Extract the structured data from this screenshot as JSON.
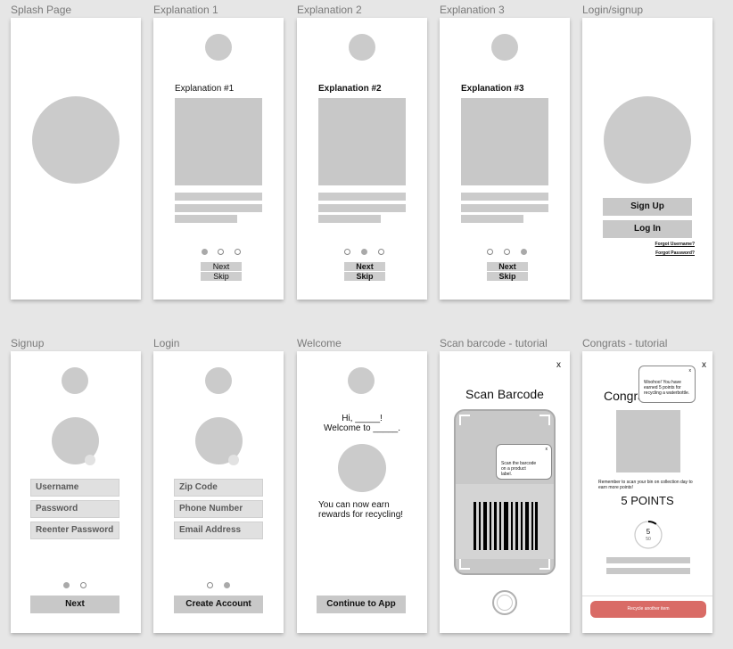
{
  "frames": {
    "splash": {
      "label": "Splash Page"
    },
    "exp1": {
      "label": "Explanation 1",
      "heading": "Explanation #1",
      "next": "Next",
      "skip": "Skip"
    },
    "exp2": {
      "label": "Explanation 2",
      "heading": "Explanation #2",
      "next": "Next",
      "skip": "Skip"
    },
    "exp3": {
      "label": "Explanation 3",
      "heading": "Explanation #3",
      "next": "Next",
      "skip": "Skip"
    },
    "loginsignup": {
      "label": "Login/signup",
      "signup": "Sign Up",
      "login": "Log In",
      "forgot_username": "Forgot Username?",
      "forgot_password": "Forgot Password?"
    },
    "signup": {
      "label": "Signup",
      "fields": [
        "Username",
        "Password",
        "Reenter Password"
      ],
      "next": "Next"
    },
    "login": {
      "label": "Login",
      "fields": [
        "Zip Code",
        "Phone Number",
        "Email Address"
      ],
      "create": "Create Account"
    },
    "welcome": {
      "label": "Welcome",
      "greeting_line1": "Hi, _____!",
      "greeting_line2": "Welcome to _____.",
      "message": "You can now earn rewards for recycling!",
      "continue": "Continue to App"
    },
    "scan": {
      "label": "Scan barcode - tutorial",
      "close": "x",
      "title": "Scan Barcode",
      "tooltip_close": "x",
      "tooltip": "Scan the barcode on a product label."
    },
    "congrats": {
      "label": "Congrats - tutorial",
      "close": "x",
      "title_partial": "Congra",
      "tooltip_close": "x",
      "tooltip": "Woohoo! You have earned 5 points for recycling a waterbottle.",
      "reminder": "Remember to scan your bin on collection day to earn more points!",
      "points": "5 POINTS",
      "progress_value": "5",
      "progress_total": "50",
      "progress_fraction": 0.1,
      "cta": "Recycle another item",
      "cta_color": "#d96b66"
    }
  }
}
